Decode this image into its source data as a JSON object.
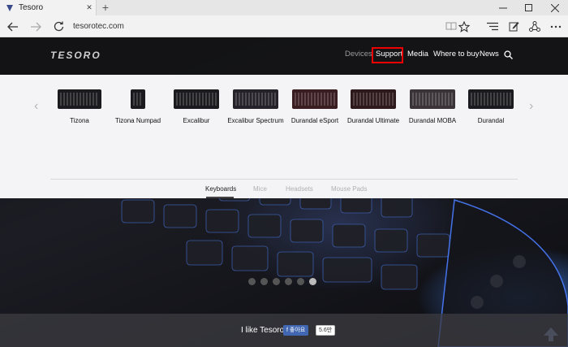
{
  "browser": {
    "tab_title": "Tesoro",
    "tab_close": "✕",
    "new_tab": "+",
    "url": "tesorotec.com",
    "icons": [
      "back-icon",
      "forward-icon",
      "refresh-icon",
      "reading-view-icon",
      "favorite-star-icon",
      "hub-icon",
      "web-note-icon",
      "share-icon",
      "more-icon"
    ]
  },
  "site": {
    "logo": "TESORO",
    "nav": [
      {
        "label": "Devices"
      },
      {
        "label": "Support"
      },
      {
        "label": "Media"
      },
      {
        "label": "Where to buy"
      },
      {
        "label": "News"
      }
    ],
    "products": [
      {
        "name": "Tizona"
      },
      {
        "name": "Tizona Numpad"
      },
      {
        "name": "Excalibur"
      },
      {
        "name": "Excalibur Spectrum"
      },
      {
        "name": "Durandal eSport"
      },
      {
        "name": "Durandal Ultimate"
      },
      {
        "name": "Durandal MOBA"
      },
      {
        "name": "Durandal"
      }
    ],
    "categories": [
      {
        "label": "Keyboards"
      },
      {
        "label": "Mice"
      },
      {
        "label": "Headsets"
      },
      {
        "label": "Mouse Pads"
      }
    ],
    "arrow_left": "‹",
    "arrow_right": "›",
    "slides": 6,
    "active_slide": 6,
    "like_text": "I like Tesoro!",
    "fb_button": "좋아요",
    "fb_count": "5.6만"
  },
  "colors": {
    "highlight": "#ee0000",
    "facebook": "#4267b2"
  }
}
